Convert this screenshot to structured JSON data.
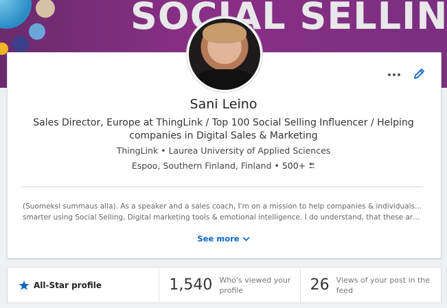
{
  "banner": {
    "text": "SOCIAL SELLING ACA"
  },
  "profile": {
    "name": "Sani Leino",
    "headline": "Sales Director, Europe at ThingLink / Top 100 Social Selling Influencer / Helping companies in Digital Sales & Marketing",
    "company": "ThingLink",
    "school": "Laurea University of Applied Sciences",
    "location": "Espoo, Southern Finland, Finland",
    "connections": "500+",
    "summary_line1": "(Suomeksi summaus alla). As a speaker and a sales coach, I'm on a mission to help companies & individuals to sell",
    "summary_line2": "smarter using Social Selling, Digital marketing tools & emotional intelligence. I do understand, that these are mainl…",
    "see_more": "See more"
  },
  "stats": {
    "allstar_label": "All-Star profile",
    "views_count": "1,540",
    "views_label_1": "Who's viewed your",
    "views_label_2": "profile",
    "post_views_count": "26",
    "post_views_label": "Views of your post in the feed"
  }
}
